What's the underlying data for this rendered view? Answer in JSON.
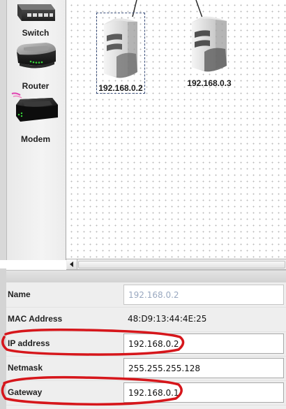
{
  "palette": {
    "items": [
      {
        "label": "Switch",
        "icon": "switch-icon"
      },
      {
        "label": "Router",
        "icon": "router-icon"
      },
      {
        "label": "Modem",
        "icon": "modem-icon"
      }
    ]
  },
  "canvas": {
    "nodes": [
      {
        "label": "192.168.0.2",
        "icon": "server-icon",
        "selected": true
      },
      {
        "label": "192.168.0.3",
        "icon": "server-icon",
        "selected": false
      }
    ]
  },
  "properties": {
    "rows": [
      {
        "label": "Name",
        "value": "192.168.0.2",
        "type": "field-disabled"
      },
      {
        "label": "MAC Address",
        "value": "48:D9:13:44:4E:25",
        "type": "readonly"
      },
      {
        "label": "IP address",
        "value": "192.168.0.2",
        "type": "field"
      },
      {
        "label": "Netmask",
        "value": "255.255.255.128",
        "type": "field"
      },
      {
        "label": "Gateway",
        "value": "192.168.0.1",
        "type": "field"
      }
    ]
  },
  "colors": {
    "annotation": "#d6161b",
    "disabled_text": "#9aa9c0",
    "selection_border": "#3b4f7a"
  }
}
